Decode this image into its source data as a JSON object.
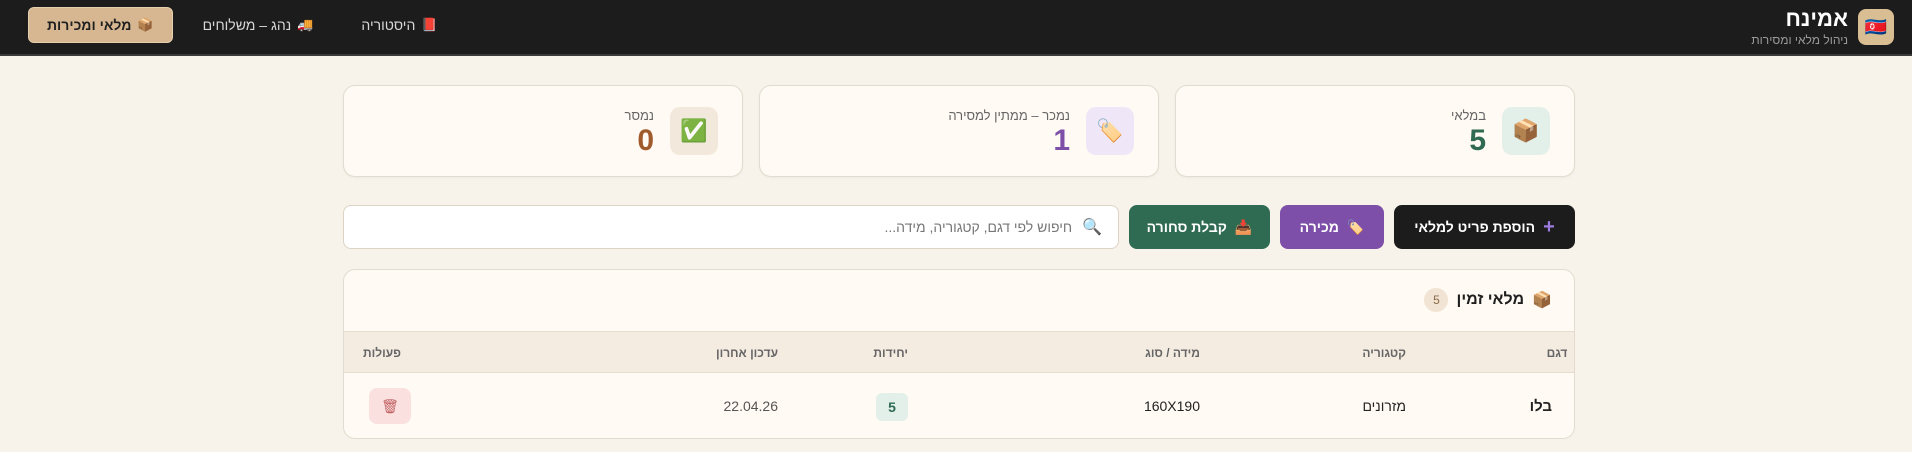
{
  "app": {
    "title": "אמינח",
    "subtitle": "ניהול מלאי ומסירות",
    "logo_icon": "flag-icon"
  },
  "nav": [
    {
      "label": "מלאי ומכירות",
      "icon": "📦",
      "active": true
    },
    {
      "label": "נהג – משלוחים",
      "icon": "🚚",
      "active": false
    },
    {
      "label": "היסטוריה",
      "icon": "📕",
      "active": false
    }
  ],
  "stats": [
    {
      "label": "במלאי",
      "value": "5",
      "icon": "📦",
      "color": "#2f6b52",
      "icon_bg": "#e3f0e9"
    },
    {
      "label": "נמכר – ממתין למסירה",
      "value": "1",
      "icon": "🏷️",
      "color": "#7d4fa8",
      "icon_bg": "#efe6f7"
    },
    {
      "label": "נמסר",
      "value": "0",
      "icon": "✅",
      "color": "#a05a2c",
      "icon_bg": "#f3e8dc"
    }
  ],
  "actions": {
    "add_label": "הוספת פריט למלאי",
    "add_icon": "+",
    "sale_label": "מכירה",
    "sale_icon": "🏷️",
    "receive_label": "קבלת סחורה",
    "receive_icon": "📥",
    "search_icon": "🔍",
    "search_placeholder": "חיפוש לפי דגם, קטגוריה, מידה...",
    "search_value": ""
  },
  "table": {
    "title": "מלאי זמין",
    "title_icon": "📦",
    "count": "5",
    "columns": {
      "model": "דגם",
      "category": "קטגוריה",
      "size": "מידה / סוג",
      "units": "יחידות",
      "updated": "עדכון אחרון",
      "actions": "פעולות"
    },
    "rows": [
      {
        "model": "בלו",
        "category": "מזרונים",
        "size": "160X190",
        "units": "5",
        "updated": "22.04.26",
        "delete_icon": "🗑"
      }
    ]
  },
  "colors": {
    "header_bg": "#1c1c1c",
    "page_bg": "#f7f2ea",
    "accent_tan": "#d6b791",
    "green": "#2f6b52",
    "purple": "#7d4fa8"
  }
}
